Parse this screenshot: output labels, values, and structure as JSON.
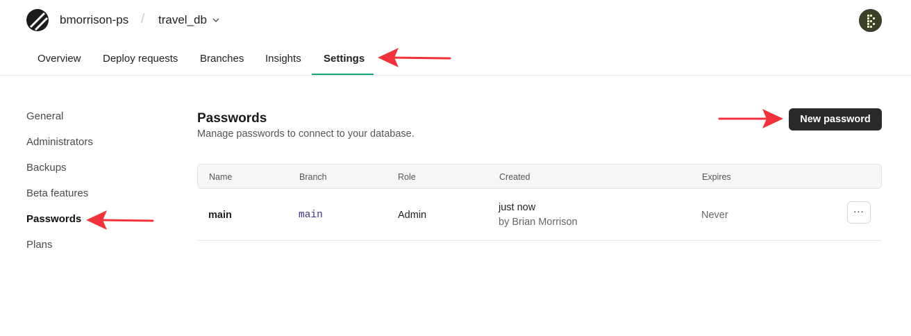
{
  "header": {
    "org_name": "bmorrison-ps",
    "separator": "/",
    "database_name": "travel_db",
    "logo_icon": "planetscale-logo-icon",
    "avatar_icon": "user-avatar-icon"
  },
  "tabs": [
    {
      "label": "Overview",
      "active": false
    },
    {
      "label": "Deploy requests",
      "active": false
    },
    {
      "label": "Branches",
      "active": false
    },
    {
      "label": "Insights",
      "active": false
    },
    {
      "label": "Settings",
      "active": true
    }
  ],
  "sidebar": {
    "items": [
      {
        "label": "General",
        "active": false
      },
      {
        "label": "Administrators",
        "active": false
      },
      {
        "label": "Backups",
        "active": false
      },
      {
        "label": "Beta features",
        "active": false
      },
      {
        "label": "Passwords",
        "active": true
      },
      {
        "label": "Plans",
        "active": false
      }
    ]
  },
  "main": {
    "title": "Passwords",
    "subtitle": "Manage passwords to connect to your database.",
    "new_button_label": "New password",
    "table": {
      "columns": [
        "Name",
        "Branch",
        "Role",
        "Created",
        "Expires"
      ],
      "rows": [
        {
          "name": "main",
          "branch": "main",
          "role": "Admin",
          "created": "just now",
          "created_by": "by Brian Morrison",
          "expires": "Never",
          "actions_label": "···"
        }
      ]
    }
  },
  "colors": {
    "accent": "#1aa37a",
    "annotation_arrow": "#f0323c",
    "button_dark": "#2a2a2a"
  }
}
